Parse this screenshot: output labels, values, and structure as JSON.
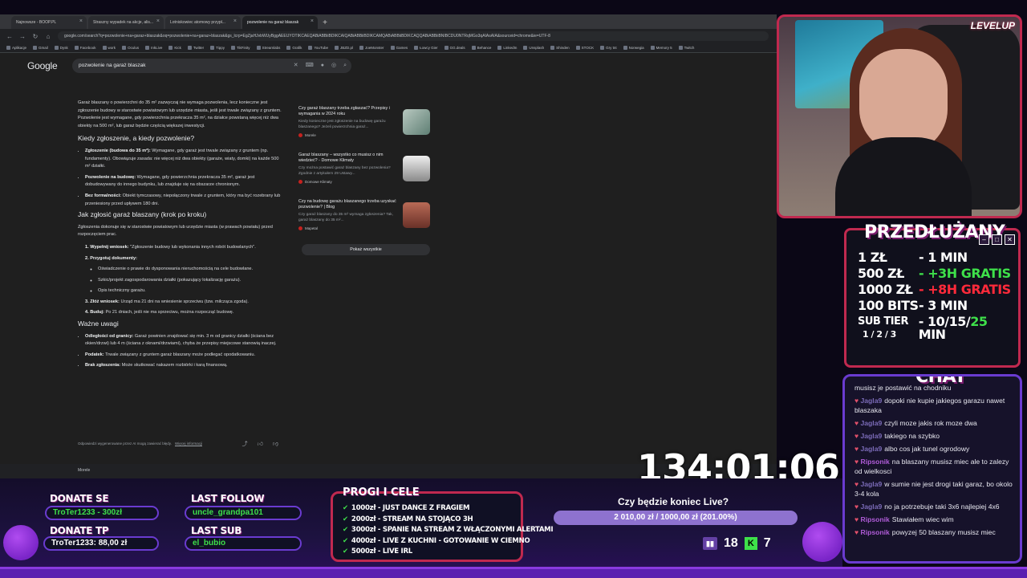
{
  "browser": {
    "tabs": [
      {
        "label": "Najnowsze - BOOP.PL",
        "active": false
      },
      {
        "label": "Straszny wypadek na akcje, alis...",
        "active": false
      },
      {
        "label": "Lotniskowiec atomowy przypł...",
        "active": false
      },
      {
        "label": "pozwolenie na garaż blaszak",
        "active": true
      }
    ],
    "new_tab": "+",
    "url": "google.com/search?q=pozwolenie+na+garaz+blaszak&oq=pozwolenie+na+garaz+blaszak&gs_lcrp=EgZjaHJvbWUyBggAEEUYOTIKCAEQABiABBiiBDIKCAIQABiABBiiBDIKCAMQABiABBiiBDIKCAQQABiABBiiBNIBCDU0NTRqMGo3qAIAsAIA&sourceid=chrome&ie=UTF-8",
    "bookmarks": [
      "Aplikacje",
      "Gmail",
      "Dysk",
      "Facebook",
      "work",
      "Oculus",
      "InkLive",
      "Kick",
      "Twitter",
      "Tippy",
      "TikFinity",
      "Streamlabs",
      "Grafik",
      "YouTube",
      "JBZD.pl",
      "JoeMonster",
      "Games",
      "Łowcy Gier",
      "GG.deals",
      "Behance",
      "LinkedIn",
      "Unsplash",
      "Shinden",
      "STOCK",
      "Gry tnt",
      "Norwegia",
      "Memory 5",
      "Twitch"
    ]
  },
  "google": {
    "logo": "Google",
    "query": "pozwolenie na garaż blaszak",
    "intro": "Garaż blaszany o powierzchni do 35 m² zazwyczaj nie wymaga pozwolenia, lecz konieczne jest zgłoszenie budowy w starostwie powiatowym lub urzędzie miasta, jeśli jest trwale związany z gruntem. Pozwolenie jest wymagane, gdy powierzchnia przekracza 35 m², na działce powstaną więcej niż dwa obiekty na 500 m², lub garaż będzie częścią większej inwestycji.",
    "h1": "Kiedy zgłoszenie, a kiedy pozwolenie?",
    "when_items": [
      {
        "bold": "Zgłoszenie (budowa do 35 m²):",
        "text": " Wymagane, gdy garaż jest trwale związany z gruntem (np. fundamenty). Obowiązuje zasada: nie więcej niż dwa obiekty (garaże, wiaty, domki) na każde 500 m² działki."
      },
      {
        "bold": "Pozwolenie na budowę:",
        "text": " Wymagane, gdy powierzchnia przekracza 35 m², garaż jest dobudowywany do innego budynku, lub znajduje się na obszarze chronionym."
      },
      {
        "bold": "Bez formalności:",
        "text": " Obiekt tymczasowy, niepołączony trwale z gruntem, który ma być rozebrany lub przeniesiony przed upływem 180 dni."
      }
    ],
    "h2": "Jak zgłosić garaż blaszany (krok po kroku)",
    "how_intro": "Zgłoszenia dokonuje się w starostwie powiatowym lub urzędzie miasta (w prawach powiatu) przed rozpoczęciem prac.",
    "steps": [
      {
        "bold": "1. Wypełnij wniosek:",
        "text": " \"Zgłoszenie budowy lub wykonania innych robót budowlanych\"."
      },
      {
        "bold": "2. Przygotuj dokumenty:",
        "text": ""
      }
    ],
    "docs": [
      "Oświadczenie o prawie do dysponowania nieruchomością na cele budowlane.",
      "Szkic/projekt zagospodarowania działki (pokazujący lokalizację garażu).",
      "Opis techniczny garażu."
    ],
    "steps2": [
      {
        "bold": "3. Złóż wniosek:",
        "text": " Urząd ma 21 dni na wniesienie sprzeciwu (tzw. milcząca zgoda)."
      },
      {
        "bold": "4. Buduj:",
        "text": " Po 21 dniach, jeśli nie ma sprzeciwu, można rozpocząć budowę."
      }
    ],
    "h3": "Ważne uwagi",
    "notes": [
      {
        "bold": "Odległości od granicy:",
        "text": " Garaż powinien znajdować się min. 3 m od granicy działki (ściana bez okien/drzwi) lub 4 m (ściana z oknami/drzwiami), chyba że przepisy miejscowe stanowią inaczej."
      },
      {
        "bold": "Podatek:",
        "text": " Trwale związany z gruntem garaż blaszany może podlegać opodatkowaniu."
      },
      {
        "bold": "Brak zgłoszenia:",
        "text": " Może skutkować nakazem rozbiórki i karą finansową."
      }
    ],
    "footer": "Odpowiedzi wygenerowane przez AI mogą zawierać błędy.",
    "footer_link": "Więcej informacji",
    "sources": [
      {
        "title": "Czy garaż blaszany trzeba zgłaszać? Przepisy i wymagania w 2024 roku",
        "desc": "Kiedy konieczne jest zgłoszenie na budowę garażu blaszanego? Jeżeli powierzchnia garaż...",
        "site": "Morele",
        "thumb": "#8aa59a"
      },
      {
        "title": "Garaż blaszany – wszystko co musisz o nim wiedzieć? - Domowe Klimaty",
        "desc": "Czy można postawić garaż blaszany bez pozwolenia? Zgodnie z artykułem 29 Ustawy...",
        "site": "Domowe Klimaty",
        "thumb": "#d0d0d0"
      },
      {
        "title": "Czy na budowę garażu blaszanego trzeba uzyskać pozwolenie? | Blog",
        "desc": "Czy garaż blaszany do 35 m² wymaga zgłoszenia? Tak, garaż blaszany do 35 m²...",
        "site": "Mapetal",
        "thumb": "#a0564a"
      }
    ],
    "show_all": "Pokaż wszystkie",
    "result_site": "Morele"
  },
  "overlay": {
    "cam_logo": "LEVELUP",
    "extend_title": "PRZEDŁUŻANY",
    "prices": [
      {
        "k": "1 ZŁ",
        "v": "- 1 MIN",
        "cls": ""
      },
      {
        "k": "500 ZŁ",
        "v": "- +3H GRATIS",
        "cls": "green"
      },
      {
        "k": "1000 ZŁ",
        "v": "- +8H GRATIS",
        "cls": "red"
      },
      {
        "k": "100 BITS",
        "v": "- 3 MIN",
        "cls": ""
      }
    ],
    "sub_tier": "SUB TIER",
    "sub_tier_nums": "1 / 2 / 3",
    "sub_values": "- 10/15/",
    "sub_last": "25",
    "sub_min": " MIN",
    "chat_title": "CHAT",
    "chat": [
      {
        "user": "",
        "text": "musisz je postawić na chodniku",
        "cls": ""
      },
      {
        "user": "Jagla9",
        "text": "dopoki nie kupie jakiegos garazu nawet blaszaka",
        "cls": "u-jagla"
      },
      {
        "user": "Jagla9",
        "text": "czyli moze jakis rok moze dwa",
        "cls": "u-jagla"
      },
      {
        "user": "Jagla9",
        "text": "takiego na szybko",
        "cls": "u-jagla"
      },
      {
        "user": "Jagla9",
        "text": "albo cos jak tunel ogrodowy",
        "cls": "u-jagla"
      },
      {
        "user": "Ripsonik",
        "text": "na blaszany musisz miec ale to zalezy od wielkosci",
        "cls": "u-rips"
      },
      {
        "user": "Jagla9",
        "text": "w sumie nie jest drogi taki garaz, bo okolo 3-4 kola",
        "cls": "u-jagla"
      },
      {
        "user": "Jagla9",
        "text": "no ja potrzebuje taki 3x6 najlepiej 4x6",
        "cls": "u-jagla"
      },
      {
        "user": "Ripsonik",
        "text": "Stawiałem wiec wim",
        "cls": "u-rips"
      },
      {
        "user": "Ripsonik",
        "text": "powyzej 50 blaszany musisz miec",
        "cls": "u-rips"
      }
    ],
    "timer": "134:01:06",
    "donate_se_label": "DONATE SE",
    "donate_se_value": "TroTer1233 - 300zł",
    "donate_tp_label": "DONATE TP",
    "donate_tp_value": "TroTer1233: 88,00 zł",
    "last_follow_label": "LAST FOLLOW",
    "last_follow_value": "uncle_grandpa101",
    "last_sub_label": "LAST SUB",
    "last_sub_value": "el_bubio",
    "goals_title": "PROGI I CELE",
    "goals": [
      "1000zł - JUST DANCE Z FRAGIEM",
      "2000zł - STREAM NA STOJĄCO 3H",
      "3000zł - SPANIE NA STREAM Z WŁĄCZONYMI ALERTAMI",
      "4000zł - LIVE Z KUCHNI - GOTOWANIE W CIEMNO",
      "5000zł - LIVE IRL"
    ],
    "poll_question": "Czy będzie koniec Live?",
    "poll_value": "2 010,00 zł / 1000,00 zł (201.00%)",
    "poll_fraction": 1.0,
    "twitch_viewers": "18",
    "kick_viewers": "7",
    "colors": {
      "accent": "#c0294f",
      "chat_border": "#6a3bd0",
      "green": "#3ee04a",
      "red": "#ff2a3a"
    }
  }
}
